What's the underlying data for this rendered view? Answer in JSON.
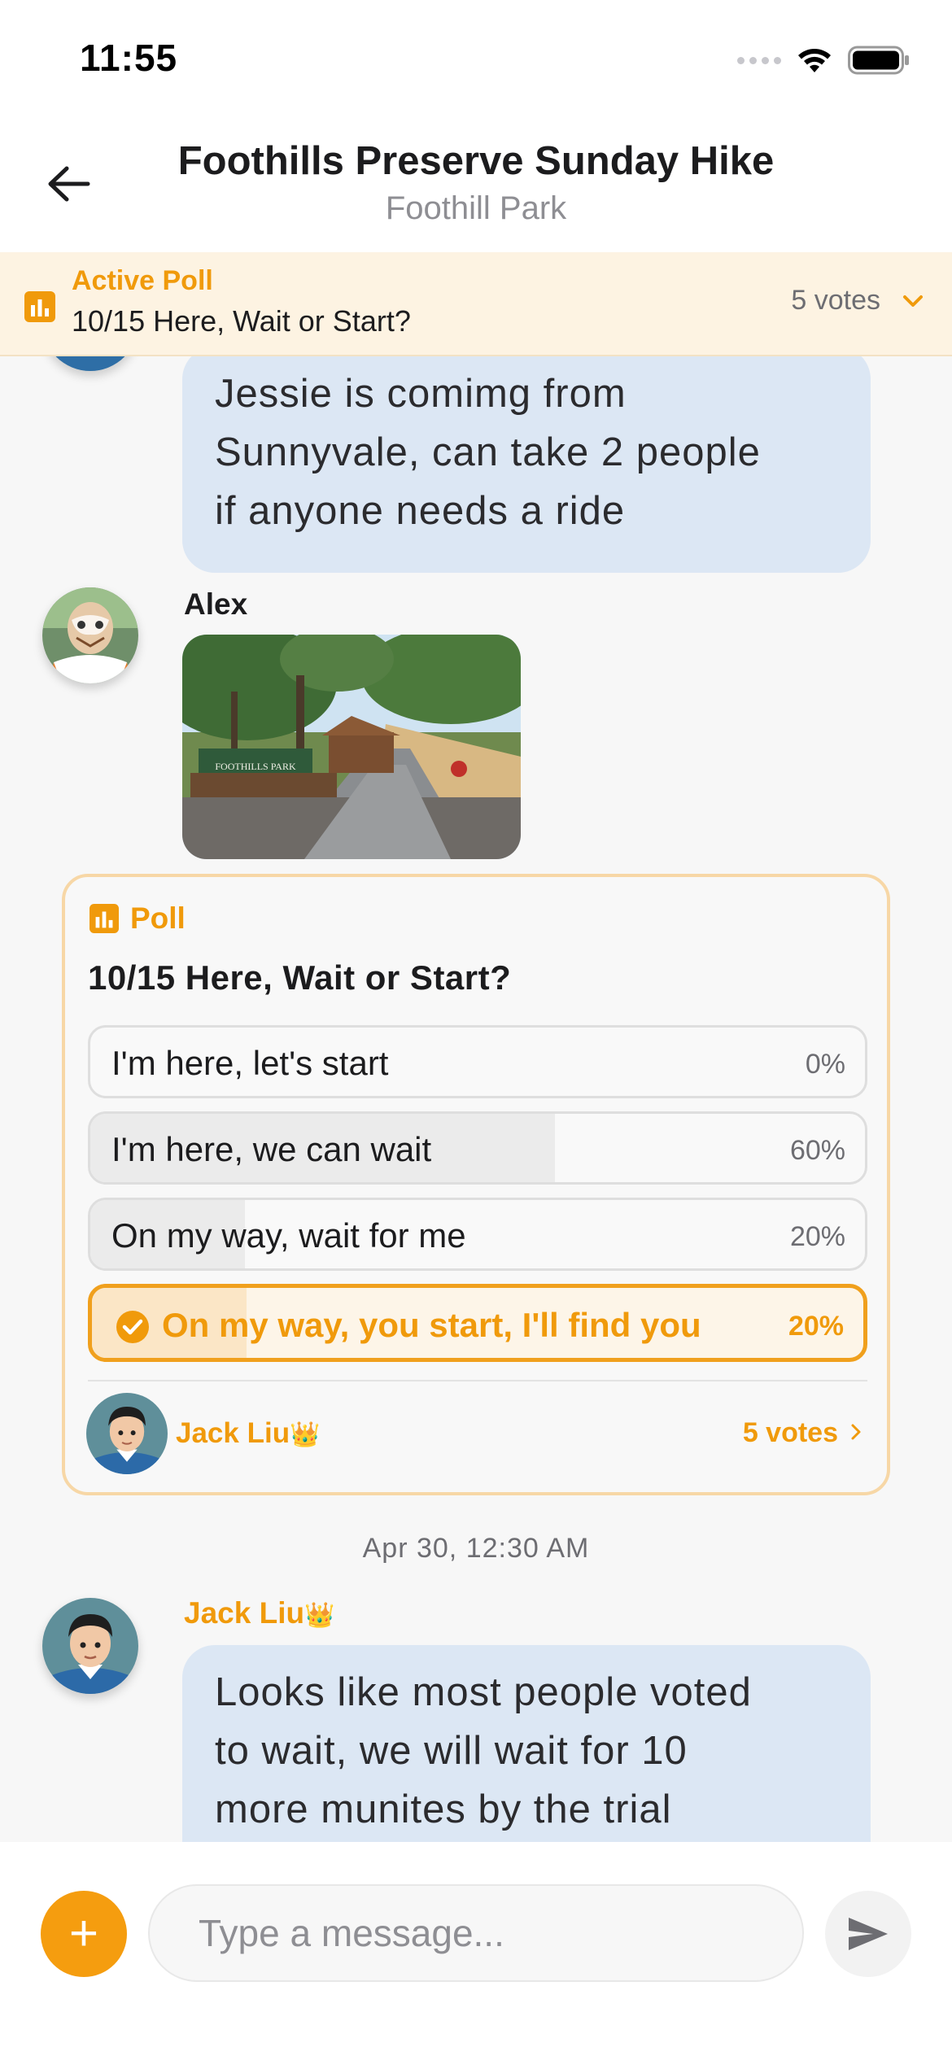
{
  "status_bar": {
    "time": "11:55"
  },
  "header": {
    "title": "Foothills Preserve Sunday Hike",
    "subtitle": "Foothill Park"
  },
  "active_poll_banner": {
    "label": "Active Poll",
    "question": "10/15 Here, Wait or Start?",
    "votes": "5 votes"
  },
  "messages": [
    {
      "sender": "",
      "text_lines": [
        "Jessie is comimg from",
        "Sunnyvale, can take 2 people",
        "if anyone needs a ride"
      ]
    },
    {
      "sender": "Alex",
      "photo_sign": "FOOTHILLS PARK"
    },
    {
      "sender": "Jack Liu",
      "text_lines": [
        "Looks like most people voted",
        "to wait, we will wait for 10",
        "more munites by the trial"
      ]
    }
  ],
  "poll": {
    "label": "Poll",
    "question": "10/15 Here, Wait or Start?",
    "options": [
      {
        "label": "I'm here, let's start",
        "percent_text": "0%",
        "percent": 0,
        "selected": false
      },
      {
        "label": "I'm here, we can wait",
        "percent_text": "60%",
        "percent": 60,
        "selected": false
      },
      {
        "label": "On my way, wait for me",
        "percent_text": "20%",
        "percent": 20,
        "selected": false
      },
      {
        "label": "On my way, you start, I'll find you",
        "percent_text": "20%",
        "percent": 20,
        "selected": true
      }
    ],
    "creator": "Jack Liu",
    "crown": "👑",
    "votes": "5 votes"
  },
  "timestamp": "Apr 30, 12:30 AM",
  "input": {
    "placeholder": "Type a message...",
    "plus_label": "+"
  },
  "colors": {
    "accent": "#f59d0f",
    "bubble": "#dce7f4",
    "banner_bg": "#fdf3e2"
  },
  "icons": [
    "back-arrow-icon",
    "bar-chart-icon",
    "chevron-down-icon",
    "check-circle-icon",
    "chevron-right-icon",
    "send-icon",
    "wifi-icon",
    "battery-icon"
  ]
}
